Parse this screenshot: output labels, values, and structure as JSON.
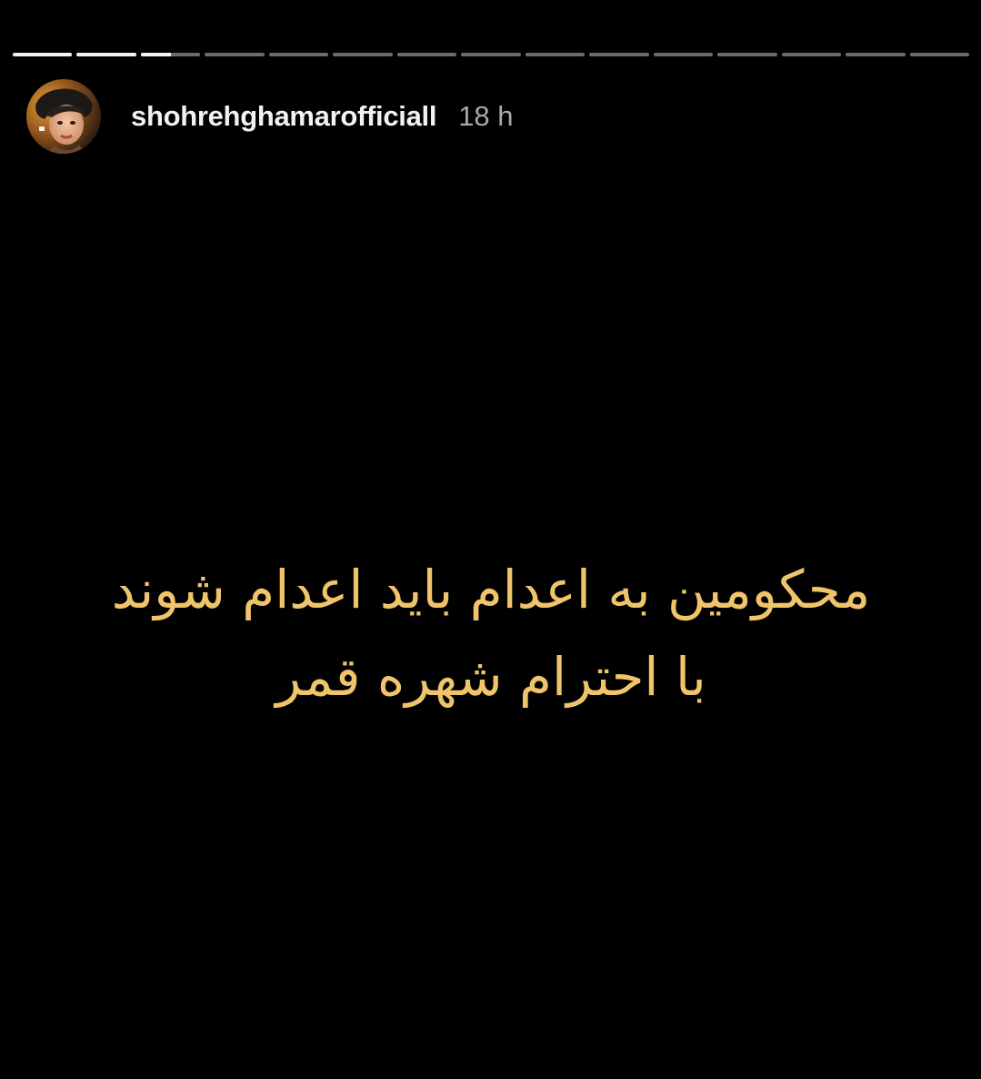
{
  "story": {
    "progress": {
      "segment_count": 15,
      "viewed_segments": 2,
      "current_segment_fraction": 0.5
    },
    "header": {
      "username": "shohrehghamarofficiall",
      "time_ago": "18 h",
      "avatar_icon": "profile-photo-icon"
    },
    "caption": {
      "line1": "محکومین به اعدام باید اعدام شوند",
      "line2": "با احترام شهره قمر"
    },
    "colors": {
      "background": "#000000",
      "caption_text": "#f0c46a",
      "progress_done": "#f4f4f4",
      "progress_pending": "#6c6c6c",
      "time_text": "#a9a9a9"
    }
  }
}
